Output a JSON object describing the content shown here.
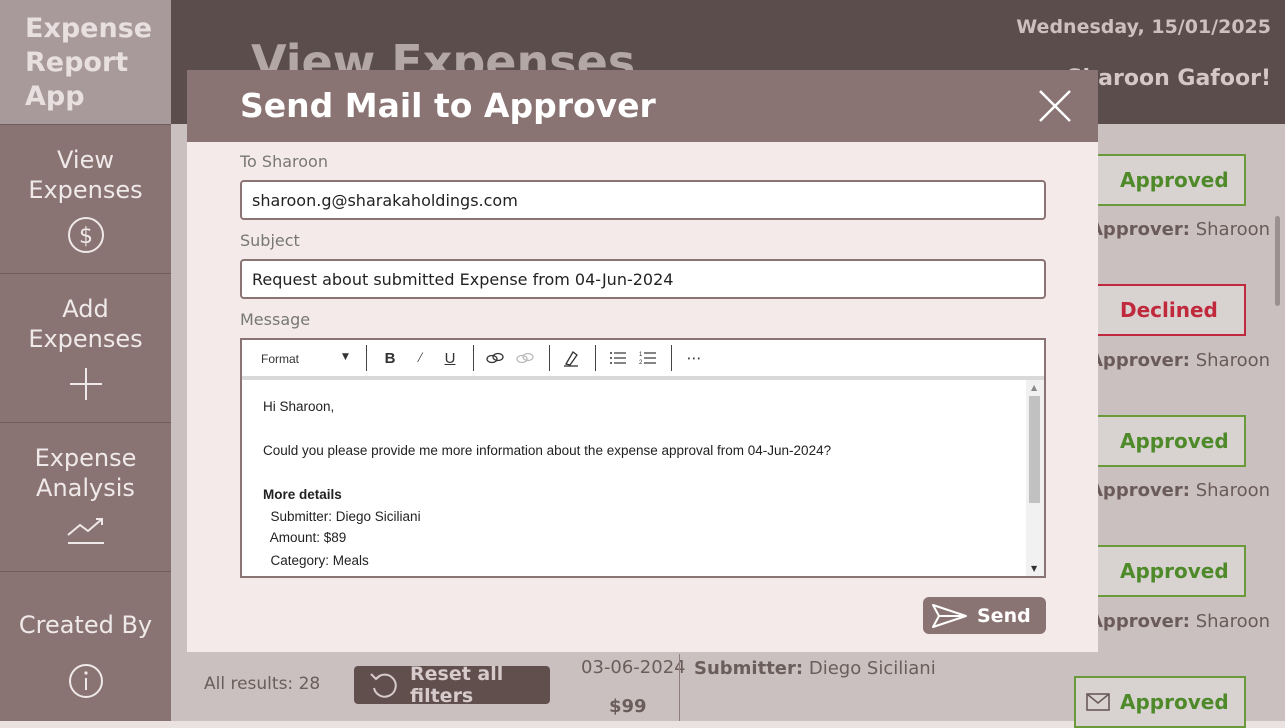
{
  "app": {
    "title": "Expense\nReport\nApp"
  },
  "sidebar": {
    "items": [
      {
        "label": "View\nExpenses",
        "icon": "dollar-circle-icon"
      },
      {
        "label": "Add\nExpenses",
        "icon": "plus-icon"
      },
      {
        "label": "Expense\nAnalysis",
        "icon": "trend-icon"
      },
      {
        "label": "Created By",
        "icon": "info-icon"
      }
    ]
  },
  "header": {
    "page_title": "View Expenses",
    "date": "Wednesday, 15/01/2025",
    "greeting": "Sharoon Gafoor!"
  },
  "list": {
    "statuses": [
      {
        "label": "Approved",
        "approver_prefix": "Approver:",
        "approver": "Sharoon"
      },
      {
        "label": "Declined",
        "approver_prefix": "Approver:",
        "approver": "Sharoon"
      },
      {
        "label": "Approved",
        "approver_prefix": "Approver:",
        "approver": "Sharoon"
      },
      {
        "label": "Approved",
        "approver_prefix": "Approver:",
        "approver": "Sharoon"
      },
      {
        "label": "Approved"
      }
    ],
    "results_text": "All results: 28",
    "reset_label": "Reset all filters",
    "row": {
      "date": "03-06-2024",
      "amount": "$99",
      "submitter_prefix": "Submitter:",
      "submitter": "Diego Siciliani"
    }
  },
  "colors": {
    "approved": "#4e8a2a",
    "declined": "#c0283c",
    "accent": "#8a7473"
  },
  "modal": {
    "title": "Send Mail to Approver",
    "to_label": "To Sharoon",
    "to_value": "sharoon.g@sharakaholdings.com",
    "subject_label": "Subject",
    "subject_value": "Request about submitted Expense from 04-Jun-2024",
    "message_label": "Message",
    "toolbar": {
      "format_label": "Format",
      "buttons": [
        "bold-icon",
        "italic-icon",
        "underline-icon",
        "link-icon",
        "unlink-icon",
        "clear-format-icon",
        "bulleted-list-icon",
        "numbered-list-icon",
        "more-icon"
      ]
    },
    "message_lines": {
      "greeting": "Hi Sharoon,",
      "body": "Could you please provide me more information about the expense approval from 04-Jun-2024?",
      "details_heading": "More details",
      "submitter": "  Submitter: Diego Siciliani",
      "amount": "  Amount: $89",
      "category": "  Category: Meals"
    },
    "send_label": "Send"
  }
}
